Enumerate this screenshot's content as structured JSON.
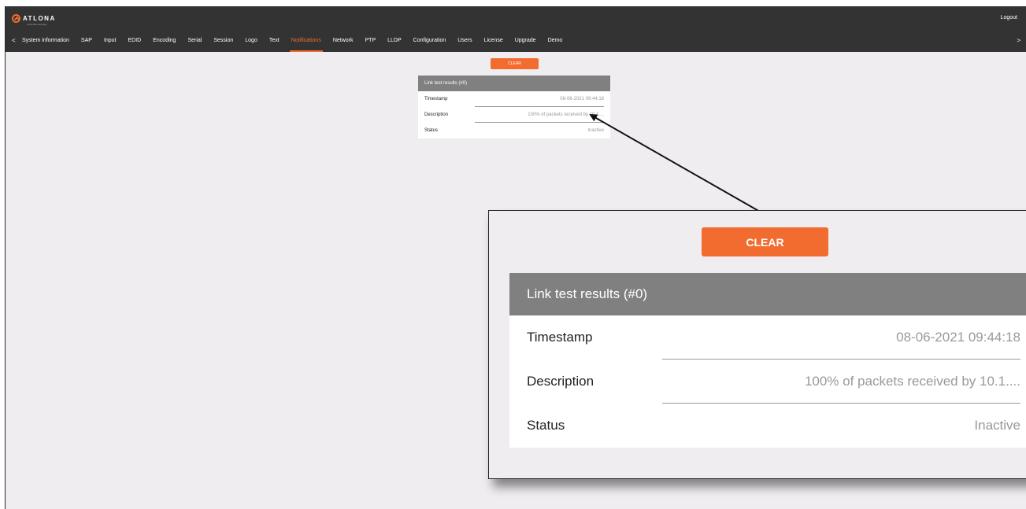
{
  "header": {
    "brand": "ATLONA",
    "brand_sub": "a Panduit company",
    "logout_label": "Logout",
    "nav_prev": "<",
    "nav_next": ">",
    "tabs": [
      {
        "label": "System information"
      },
      {
        "label": "SAP"
      },
      {
        "label": "Input"
      },
      {
        "label": "EDID"
      },
      {
        "label": "Encoding"
      },
      {
        "label": "Serial"
      },
      {
        "label": "Session"
      },
      {
        "label": "Logo"
      },
      {
        "label": "Text"
      },
      {
        "label": "Notifications"
      },
      {
        "label": "Network"
      },
      {
        "label": "PTP"
      },
      {
        "label": "LLDP"
      },
      {
        "label": "Configuration"
      },
      {
        "label": "Users"
      },
      {
        "label": "License"
      },
      {
        "label": "Upgrade"
      },
      {
        "label": "Demo"
      }
    ],
    "active_tab": "Notifications"
  },
  "notifications": {
    "clear_label": "CLEAR",
    "card_title": "Link test results (#0)",
    "rows": [
      {
        "key": "Timestamp",
        "value": "08-06-2021 09:44:18"
      },
      {
        "key": "Description",
        "value": "100% of packets received by 10.1...."
      },
      {
        "key": "Status",
        "value": "Inactive"
      }
    ]
  },
  "colors": {
    "accent": "#f26b2f",
    "topbar": "#333333",
    "card_header": "#808080",
    "page_bg": "#efedf0"
  }
}
